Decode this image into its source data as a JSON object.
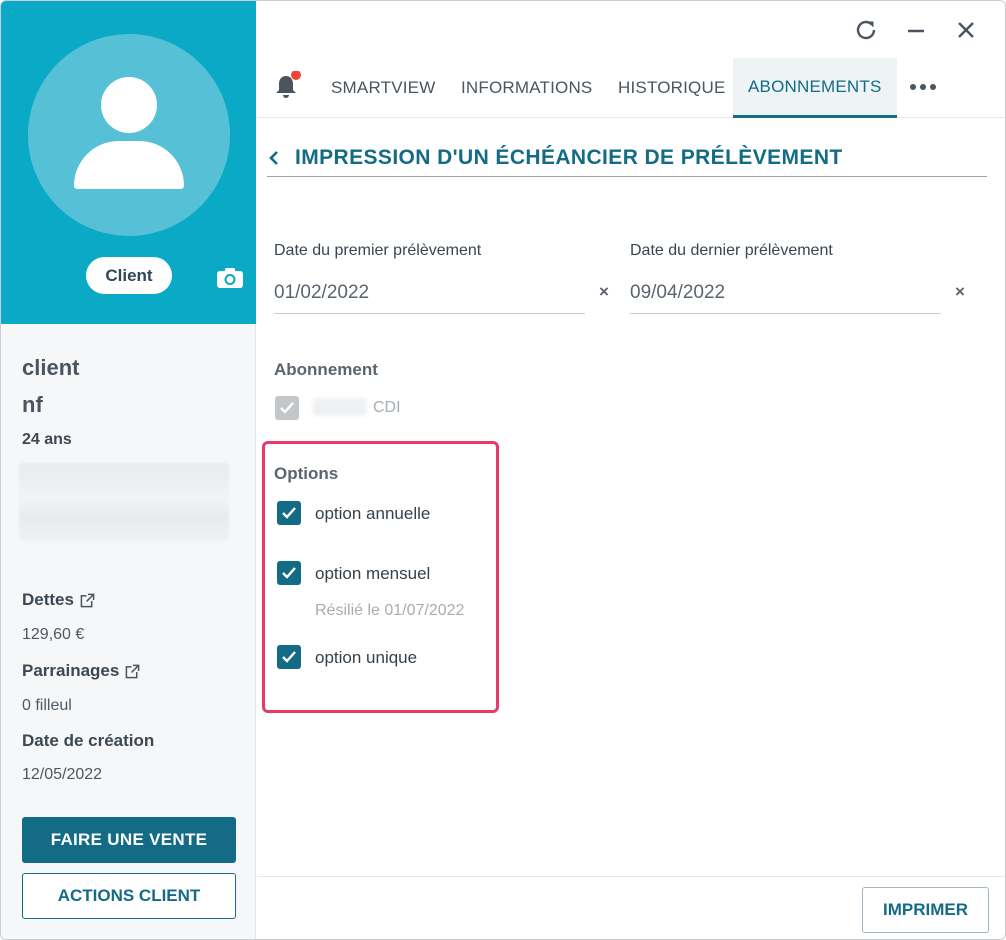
{
  "window_controls": {
    "refresh": "refresh-icon",
    "minimize": "minimize-icon",
    "close": "close-icon"
  },
  "sidebar": {
    "badge": "Client",
    "name_line1": "client",
    "name_line2": "nf",
    "age": "24 ans",
    "debts_label": "Dettes",
    "debts_value": "129,60 €",
    "referrals_label": "Parrainages",
    "referrals_value": "0 filleul",
    "created_label": "Date de création",
    "created_value": "12/05/2022",
    "primary_button": "FAIRE UNE VENTE",
    "secondary_button": "ACTIONS CLIENT"
  },
  "tabs": [
    {
      "label": "SMARTVIEW",
      "active": false
    },
    {
      "label": "INFORMATIONS",
      "active": false
    },
    {
      "label": "HISTORIQUE",
      "active": false
    },
    {
      "label": "ABONNEMENTS",
      "active": true
    }
  ],
  "page": {
    "title": "IMPRESSION D'UN ÉCHÉANCIER DE PRÉLÈVEMENT",
    "first_date_label": "Date du premier prélèvement",
    "first_date_value": "01/02/2022",
    "last_date_label": "Date du dernier prélèvement",
    "last_date_value": "09/04/2022",
    "clear_symbol": "×",
    "subscription_label": "Abonnement",
    "subscription_item": "CDI",
    "options_label": "Options",
    "options": [
      {
        "label": "option annuelle",
        "checked": true
      },
      {
        "label": "option mensuel",
        "checked": true,
        "note": "Résilié le 01/07/2022"
      },
      {
        "label": "option unique",
        "checked": true
      }
    ],
    "print_button": "IMPRIMER"
  },
  "colors": {
    "accent": "#146b86",
    "header_bg": "#0aa9c6",
    "highlight": "#e8396b",
    "notification": "#f04438"
  }
}
